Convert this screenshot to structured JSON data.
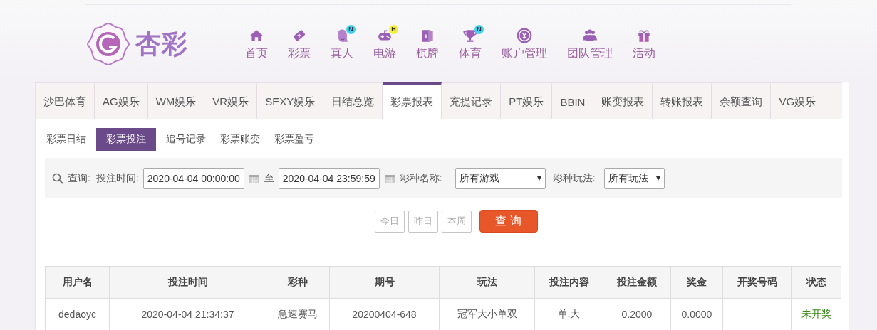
{
  "logo": {
    "text": "杏彩"
  },
  "nav": [
    {
      "label": "首页"
    },
    {
      "label": "彩票"
    },
    {
      "label": "真人",
      "badge": "N",
      "color": "#3fd0f0"
    },
    {
      "label": "电游",
      "badge": "H",
      "color": "#f5f03c"
    },
    {
      "label": "棋牌"
    },
    {
      "label": "体育",
      "badge": "N",
      "color": "#3fd0f0"
    },
    {
      "label": "账户管理"
    },
    {
      "label": "团队管理"
    },
    {
      "label": "活动"
    }
  ],
  "tabs": [
    {
      "label": "沙巴体育",
      "selected": false
    },
    {
      "label": "AG娱乐",
      "selected": false
    },
    {
      "label": "WM娱乐",
      "selected": false
    },
    {
      "label": "VR娱乐",
      "selected": false
    },
    {
      "label": "SEXY娱乐",
      "selected": false
    },
    {
      "label": "日结总览",
      "selected": false
    },
    {
      "label": "彩票报表",
      "selected": true
    },
    {
      "label": "充提记录",
      "selected": false
    },
    {
      "label": "PT娱乐",
      "selected": false
    },
    {
      "label": "BBIN",
      "selected": false
    },
    {
      "label": "账变报表",
      "selected": false
    },
    {
      "label": "转账报表",
      "selected": false
    },
    {
      "label": "余额查询",
      "selected": false
    },
    {
      "label": "VG娱乐",
      "selected": false
    }
  ],
  "subtabs": [
    {
      "label": "彩票日结",
      "selected": false
    },
    {
      "label": "彩票投注",
      "selected": true
    },
    {
      "label": "追号记录",
      "selected": false
    },
    {
      "label": "彩票账变",
      "selected": false
    },
    {
      "label": "彩票盈亏",
      "selected": false
    }
  ],
  "filter": {
    "query_label": "查询:",
    "time_label": "投注时间:",
    "start": "2020-04-04 00:00:00",
    "to": "至",
    "end": "2020-04-04 23:59:59",
    "game_label": "彩种名称:",
    "game": "所有游戏",
    "play_label": "彩种玩法:",
    "play": "所有玩法"
  },
  "quick_buttons": [
    "今日",
    "昨日",
    "本周"
  ],
  "search_button": "查 询",
  "table": {
    "columns": [
      "用户名",
      "投注时间",
      "彩种",
      "期号",
      "玩法",
      "投注内容",
      "投注金额",
      "奖金",
      "开奖号码",
      "状态"
    ],
    "rows": [
      [
        "dedaoyc",
        "2020-04-04 21:34:37",
        "急速赛马",
        "20200404-648",
        "冠军大小单双",
        "单,大",
        "0.2000",
        "0.0000",
        "",
        "未开奖"
      ]
    ]
  }
}
